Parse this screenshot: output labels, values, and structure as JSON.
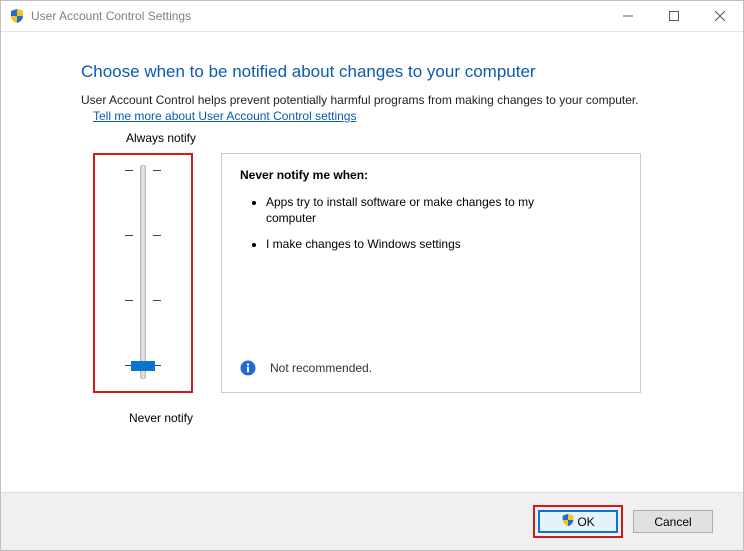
{
  "window": {
    "title": "User Account Control Settings"
  },
  "page": {
    "heading": "Choose when to be notified about changes to your computer",
    "description": "User Account Control helps prevent potentially harmful programs from making changes to your computer.",
    "help_link": "Tell me more about User Account Control settings"
  },
  "slider": {
    "top_label": "Always notify",
    "bottom_label": "Never notify",
    "levels": 4,
    "current_level": 0
  },
  "info_panel": {
    "heading": "Never notify me when:",
    "bullets": [
      "Apps try to install software or make changes to my computer",
      "I make changes to Windows settings"
    ],
    "note": "Not recommended."
  },
  "buttons": {
    "ok": "OK",
    "cancel": "Cancel"
  },
  "icons": {
    "shield": "shield-icon",
    "info": "info-icon"
  }
}
